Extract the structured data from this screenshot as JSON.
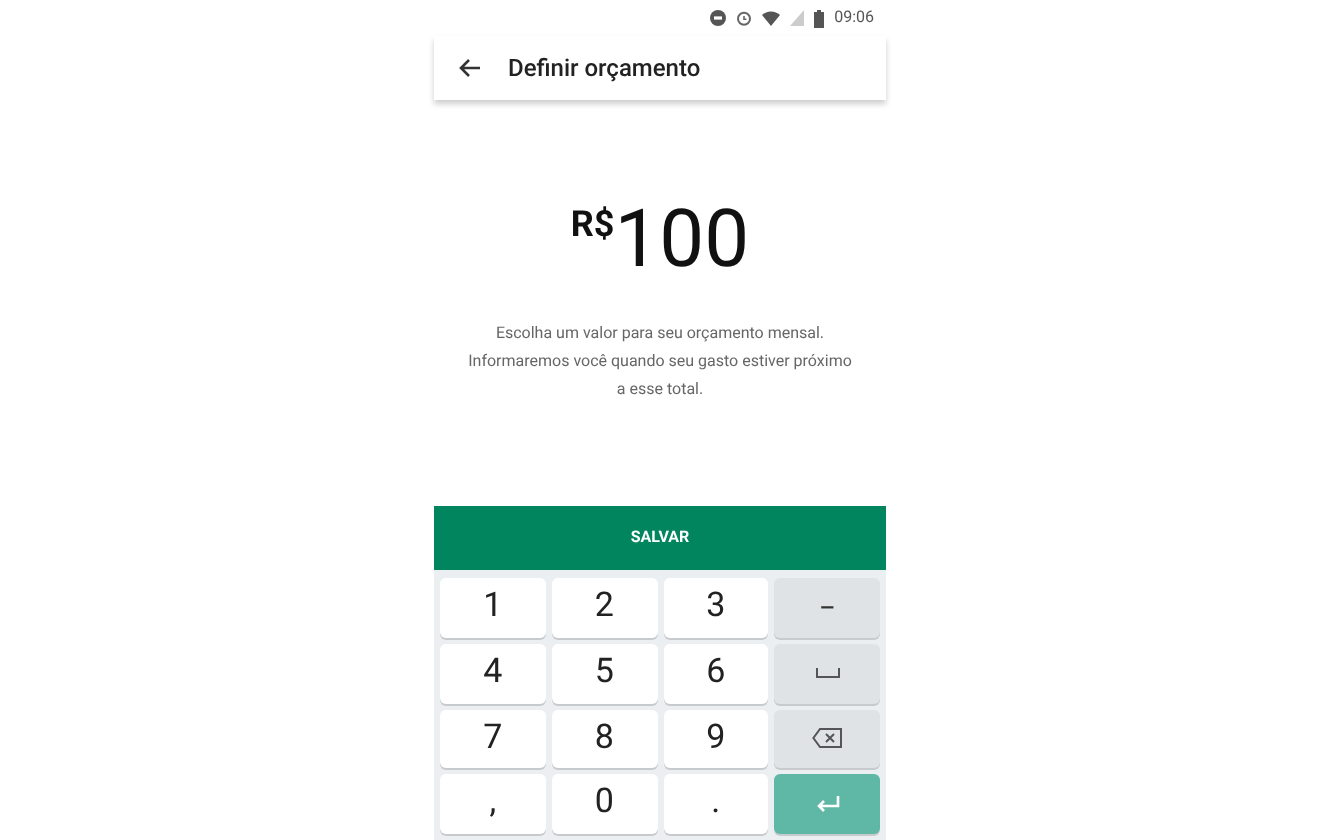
{
  "status_bar": {
    "time": "09:06"
  },
  "app_bar": {
    "title": "Definir orçamento"
  },
  "amount": {
    "currency": "R$",
    "value": "100"
  },
  "description": "Escolha um valor para seu orçamento mensal. Informaremos você quando seu gasto estiver próximo a esse total.",
  "save_button": "SALVAR",
  "keyboard": {
    "keys": [
      {
        "kind": "digit",
        "label": "1"
      },
      {
        "kind": "digit",
        "label": "2"
      },
      {
        "kind": "digit",
        "label": "3"
      },
      {
        "kind": "symbol",
        "label": "−"
      },
      {
        "kind": "digit",
        "label": "4"
      },
      {
        "kind": "digit",
        "label": "5"
      },
      {
        "kind": "digit",
        "label": "6"
      },
      {
        "kind": "space"
      },
      {
        "kind": "digit",
        "label": "7"
      },
      {
        "kind": "digit",
        "label": "8"
      },
      {
        "kind": "digit",
        "label": "9"
      },
      {
        "kind": "backspace"
      },
      {
        "kind": "digit",
        "label": ","
      },
      {
        "kind": "digit",
        "label": "0"
      },
      {
        "kind": "digit",
        "label": "."
      },
      {
        "kind": "enter"
      }
    ]
  }
}
